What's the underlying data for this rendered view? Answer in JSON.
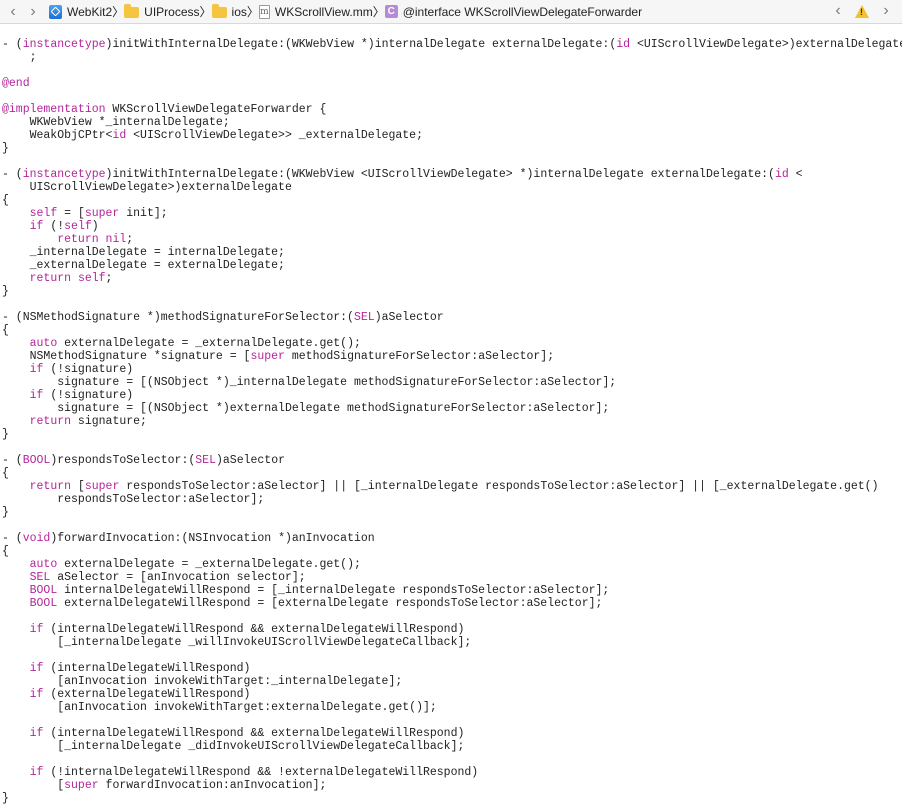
{
  "jumpbar": {
    "back_icon": "chevron-left-icon",
    "forward_icon": "chevron-right-icon",
    "breadcrumbs": [
      {
        "label": "WebKit2",
        "icon": "xcode-project-icon"
      },
      {
        "label": "UIProcess",
        "icon": "folder-icon"
      },
      {
        "label": "ios",
        "icon": "folder-icon"
      },
      {
        "label": "WKScrollView.mm",
        "icon": "objc-file-icon"
      },
      {
        "label": "@interface WKScrollViewDelegateForwarder",
        "icon": "class-icon"
      }
    ],
    "warning_icon": "warning-icon",
    "colors": {
      "keyword": "#b4269a",
      "text": "#222222",
      "bar": "#f6f6f6",
      "warning": "#f4c02b"
    }
  },
  "code_lines": [
    "",
    "- (instancetype)initWithInternalDelegate:(WKWebView *)internalDelegate externalDelegate:(id <UIScrollViewDelegate>)externalDelegate",
    "    ;",
    "",
    "@end",
    "",
    "@implementation WKScrollViewDelegateForwarder {",
    "    WKWebView *_internalDelegate;",
    "    WeakObjCPtr<id <UIScrollViewDelegate>> _externalDelegate;",
    "}",
    "",
    "- (instancetype)initWithInternalDelegate:(WKWebView <UIScrollViewDelegate> *)internalDelegate externalDelegate:(id <",
    "    UIScrollViewDelegate>)externalDelegate",
    "{",
    "    self = [super init];",
    "    if (!self)",
    "        return nil;",
    "    _internalDelegate = internalDelegate;",
    "    _externalDelegate = externalDelegate;",
    "    return self;",
    "}",
    "",
    "- (NSMethodSignature *)methodSignatureForSelector:(SEL)aSelector",
    "{",
    "    auto externalDelegate = _externalDelegate.get();",
    "    NSMethodSignature *signature = [super methodSignatureForSelector:aSelector];",
    "    if (!signature)",
    "        signature = [(NSObject *)_internalDelegate methodSignatureForSelector:aSelector];",
    "    if (!signature)",
    "        signature = [(NSObject *)externalDelegate methodSignatureForSelector:aSelector];",
    "    return signature;",
    "}",
    "",
    "- (BOOL)respondsToSelector:(SEL)aSelector",
    "{",
    "    return [super respondsToSelector:aSelector] || [_internalDelegate respondsToSelector:aSelector] || [_externalDelegate.get()",
    "        respondsToSelector:aSelector];",
    "}",
    "",
    "- (void)forwardInvocation:(NSInvocation *)anInvocation",
    "{",
    "    auto externalDelegate = _externalDelegate.get();",
    "    SEL aSelector = [anInvocation selector];",
    "    BOOL internalDelegateWillRespond = [_internalDelegate respondsToSelector:aSelector];",
    "    BOOL externalDelegateWillRespond = [externalDelegate respondsToSelector:aSelector];",
    "",
    "    if (internalDelegateWillRespond && externalDelegateWillRespond)",
    "        [_internalDelegate _willInvokeUIScrollViewDelegateCallback];",
    "",
    "    if (internalDelegateWillRespond)",
    "        [anInvocation invokeWithTarget:_internalDelegate];",
    "    if (externalDelegateWillRespond)",
    "        [anInvocation invokeWithTarget:externalDelegate.get()];",
    "",
    "    if (internalDelegateWillRespond && externalDelegateWillRespond)",
    "        [_internalDelegate _didInvokeUIScrollViewDelegateCallback];",
    "",
    "    if (!internalDelegateWillRespond && !externalDelegateWillRespond)",
    "        [super forwardInvocation:anInvocation];",
    "}"
  ],
  "syntax_keywords": [
    "instancetype",
    "id",
    "self",
    "super",
    "if",
    "return",
    "nil",
    "auto",
    "SEL",
    "BOOL",
    "void",
    "@end",
    "@implementation"
  ]
}
